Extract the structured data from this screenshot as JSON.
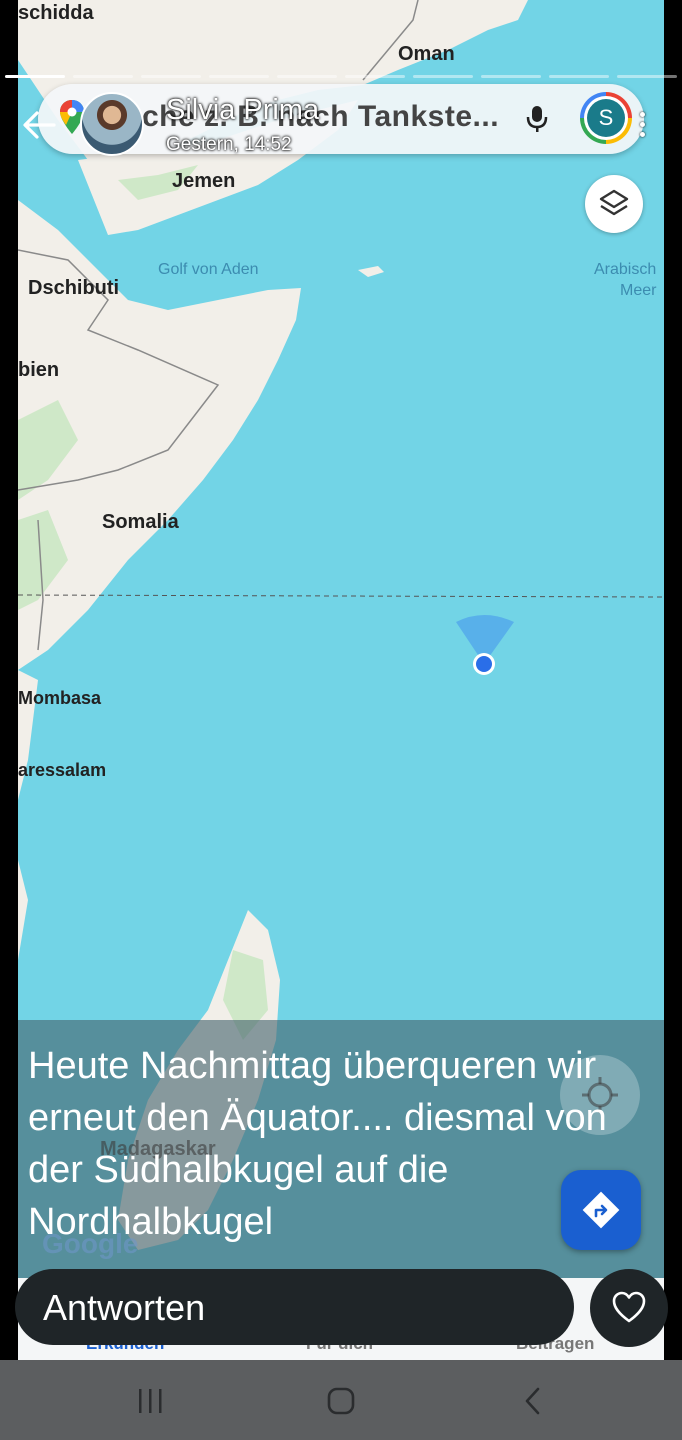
{
  "story": {
    "progress_segments": 10,
    "active_segment": 0,
    "username": "Silvia Prima",
    "timestamp": "Gestern, 14:52",
    "caption": "Heute Nachmittag überqueren wir erneut den Äquator.... diesmal von der Südhalbkugel auf die Nordhalbkugel"
  },
  "maps": {
    "search_text": "che z. B. nach Tankste...",
    "account_letter": "S",
    "labels": {
      "oman": "Oman",
      "dschidda": "schidda",
      "jemen": "Jemen",
      "golf": "Golf von Aden",
      "arab1": "Arabisch",
      "arab2": "Meer",
      "dschibuti": "Dschibuti",
      "bien": "bien",
      "somalia": "Somalia",
      "mombasa": "Mombasa",
      "daressalam": "aressalam",
      "madagaskar": "Madagaskar"
    },
    "google": "Google",
    "tabs": [
      "Erkunden",
      "Für dich",
      "Beitragen"
    ],
    "accent": "#1a5fd0"
  },
  "reply": {
    "placeholder": "Antworten"
  },
  "icons": {
    "back": "back-arrow-icon",
    "mic": "microphone-icon",
    "layers": "layers-icon",
    "heart": "heart-icon",
    "directions": "directions-icon",
    "locate": "my-location-icon"
  }
}
